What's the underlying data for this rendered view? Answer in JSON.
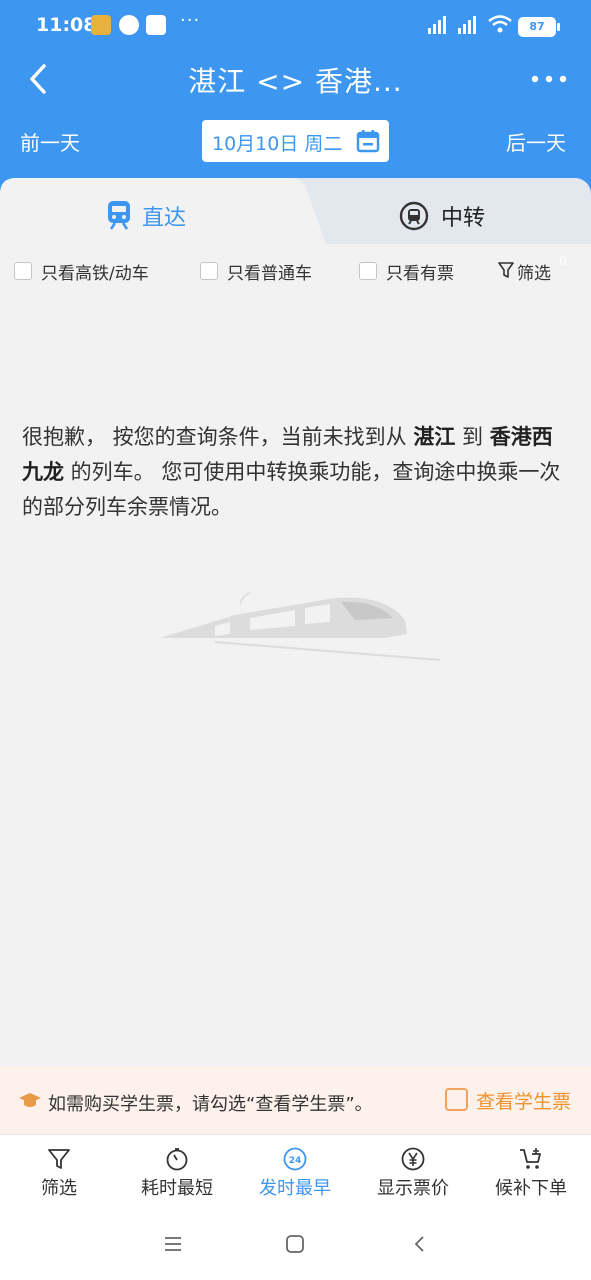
{
  "status_bar": {
    "time": "11:08",
    "battery": "87",
    "more": "···"
  },
  "header": {
    "title": "湛江 <> 香港...",
    "prev_day": "前一天",
    "next_day": "后一天",
    "date": "10月10日 周二"
  },
  "tabs": [
    {
      "label": "直达",
      "active": true
    },
    {
      "label": "中转",
      "active": false
    }
  ],
  "filters": {
    "high_speed_only": "只看高铁/动车",
    "normal_only": "只看普通车",
    "available_only": "只看有票",
    "filter_button": "筛选",
    "filter_count": "0"
  },
  "message": {
    "part1": "很抱歉， 按您的查询条件，当前未找到从 ",
    "from": "湛江",
    "part2": " 到 ",
    "to": "香港西九龙",
    "part3": " 的列车。 您可使用中转换乘功能，查询途中换乘一次的部分列车余票情况。"
  },
  "student": {
    "hint": "如需购买学生票，请勾选“查看学生票”。",
    "toggle_label": "查看学生票"
  },
  "toolbar": [
    {
      "label": "筛选",
      "icon": "filter-icon"
    },
    {
      "label": "耗时最短",
      "icon": "timer-icon"
    },
    {
      "label": "发时最早",
      "icon": "clock-24-icon",
      "badge": "24",
      "active": true
    },
    {
      "label": "显示票价",
      "icon": "yuan-icon"
    },
    {
      "label": "候补下单",
      "icon": "cart-icon"
    }
  ],
  "colors": {
    "primary": "#3d97f0",
    "accent": "#f0932e"
  }
}
